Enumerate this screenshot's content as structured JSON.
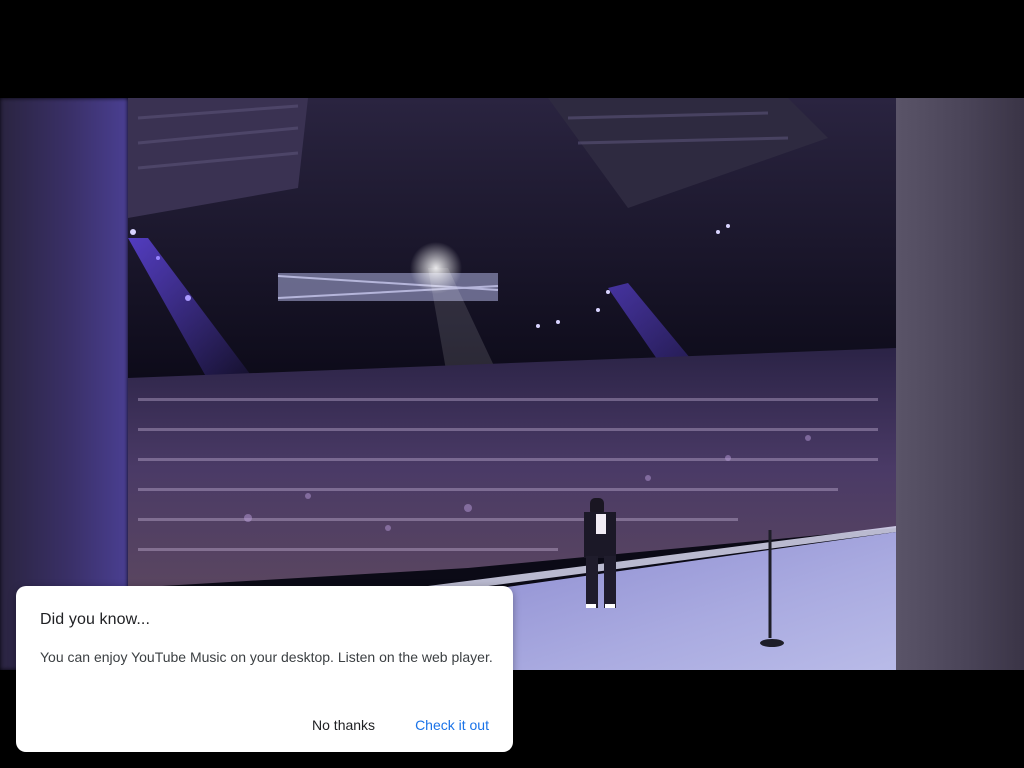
{
  "colors": {
    "dialog_background": "#ffffff",
    "primary_action": "#1a73e8",
    "text_primary": "#202124",
    "stage_light": "#6a4cff"
  },
  "video": {
    "description_icon": "concert-video-frame"
  },
  "dialog": {
    "title": "Did you know...",
    "message": "You can enjoy YouTube Music on your desktop. Listen on the web player.",
    "secondary_action": "No thanks",
    "primary_action": "Check it out"
  }
}
